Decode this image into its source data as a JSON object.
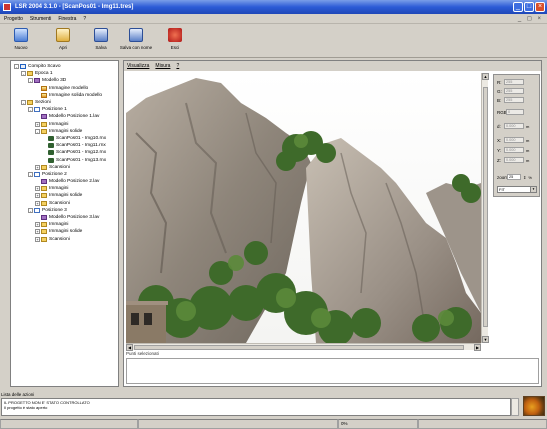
{
  "window": {
    "title": "LSR 2004  3.1.0 - [ScanPos01 - Img11.tres]",
    "controls": [
      "_",
      "□",
      "×"
    ]
  },
  "menubar": {
    "items": [
      "Progetto",
      "Strumenti",
      "Finestra",
      "?"
    ],
    "doc_controls": "_ ◻ ×"
  },
  "toolbar": {
    "buttons": [
      {
        "label": "Nuovo",
        "icon": "new-project-icon"
      },
      {
        "label": "Apri",
        "icon": "open-folder-icon"
      },
      {
        "label": "Salva",
        "icon": "save-disk-icon"
      },
      {
        "label": "Salva con nome",
        "icon": "save-as-icon"
      },
      {
        "label": "Esci",
        "icon": "exit-icon"
      }
    ]
  },
  "tree": {
    "nodes": [
      {
        "level": 0,
        "exp": "-",
        "icon": "doc2",
        "label": "Compito Scavo"
      },
      {
        "level": 1,
        "exp": "-",
        "icon": "fld",
        "label": "Epoca 1"
      },
      {
        "level": 2,
        "exp": "-",
        "icon": "grp",
        "label": "Modello 3D"
      },
      {
        "level": 3,
        "exp": "",
        "icon": "img",
        "label": "Immagine modello"
      },
      {
        "level": 3,
        "exp": "",
        "icon": "img",
        "label": "Immagine solida modello"
      },
      {
        "level": 1,
        "exp": "-",
        "icon": "fld",
        "label": "Sezioni"
      },
      {
        "level": 2,
        "exp": "-",
        "icon": "doc",
        "label": "Posizione 1"
      },
      {
        "level": 3,
        "exp": "",
        "icon": "grp",
        "label": "Modello Posizione 1.lav"
      },
      {
        "level": 3,
        "exp": "+",
        "icon": "fld",
        "label": "Immagini"
      },
      {
        "level": 3,
        "exp": "-",
        "icon": "fld",
        "label": "Immagini solide"
      },
      {
        "level": 4,
        "exp": "",
        "icon": "cam",
        "label": "ScanPos01 - Img10.rnx"
      },
      {
        "level": 4,
        "exp": "",
        "icon": "cam",
        "label": "ScanPos01 - Img11.rnx"
      },
      {
        "level": 4,
        "exp": "",
        "icon": "cam",
        "label": "ScanPos01 - Img12.rnx"
      },
      {
        "level": 4,
        "exp": "",
        "icon": "cam",
        "label": "ScanPos01 - Img13.rnx"
      },
      {
        "level": 3,
        "exp": "+",
        "icon": "fld",
        "label": "Scansioni"
      },
      {
        "level": 2,
        "exp": "-",
        "icon": "doc",
        "label": "Posizione 2"
      },
      {
        "level": 3,
        "exp": "",
        "icon": "grp",
        "label": "Modello Posizione 2.lav"
      },
      {
        "level": 3,
        "exp": "+",
        "icon": "fld",
        "label": "Immagini"
      },
      {
        "level": 3,
        "exp": "+",
        "icon": "fld",
        "label": "Immagini solide"
      },
      {
        "level": 3,
        "exp": "+",
        "icon": "fld",
        "label": "Scansioni"
      },
      {
        "level": 2,
        "exp": "-",
        "icon": "doc",
        "label": "Posizione 3"
      },
      {
        "level": 3,
        "exp": "",
        "icon": "grp",
        "label": "Modello Posizione 3.lav"
      },
      {
        "level": 3,
        "exp": "+",
        "icon": "fld",
        "label": "Immagini"
      },
      {
        "level": 3,
        "exp": "+",
        "icon": "fld",
        "label": "Immagini solide"
      },
      {
        "level": 3,
        "exp": "+",
        "icon": "fld",
        "label": "Scansioni"
      }
    ]
  },
  "viewer": {
    "menu": [
      "Visualizza",
      "Misura",
      "?"
    ],
    "position_label": "Punti selezionati",
    "rgb": {
      "r_label": "R:",
      "r_value": "255",
      "g_label": "G:",
      "g_value": "255",
      "b_label": "B:",
      "b_value": "255",
      "rgb_label": "RGB:",
      "rgb_value": "0",
      "d_label": "d:",
      "d_value": "0.000",
      "x_label": "X:",
      "x_value": "0.000",
      "y_label": "Y:",
      "y_value": "0.000",
      "z_label": "Z:",
      "z_value": "0.000",
      "unit": "m",
      "zoom_label": "zoom",
      "zoom_value": "25",
      "zoom_unit": "%",
      "fit_label": "FIT"
    }
  },
  "log": {
    "label": "Lista delle azioni",
    "lines": [
      "IL PROGETTO NON E' STATO CONTROLLATO",
      "Il progetto è stato aperto"
    ]
  },
  "status": {
    "cells": [
      "",
      "",
      "0%",
      ""
    ]
  }
}
